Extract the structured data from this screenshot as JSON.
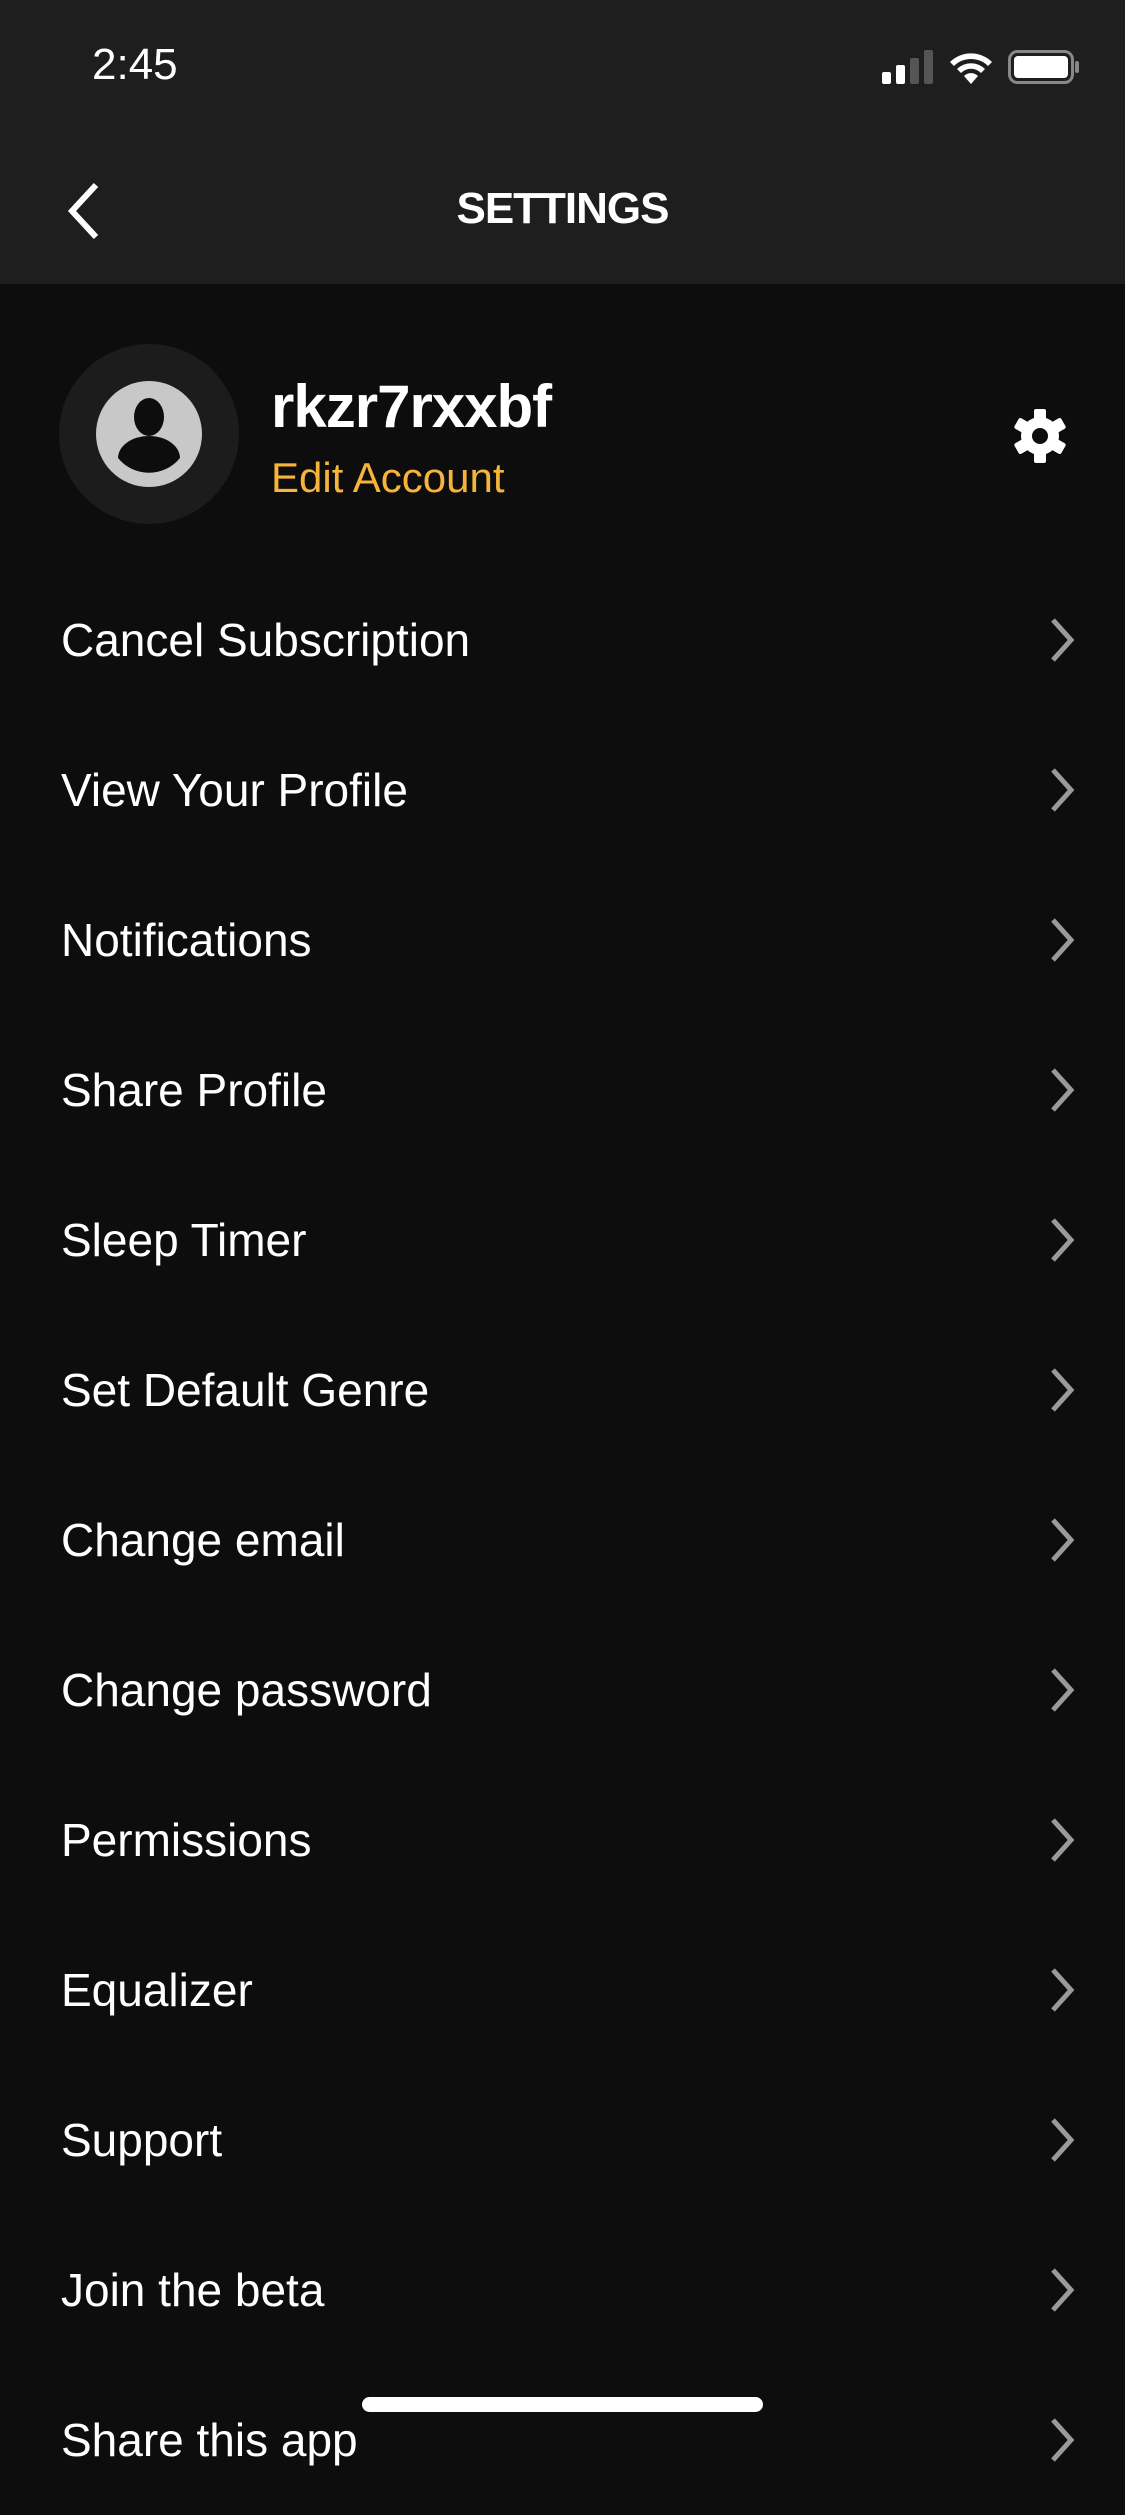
{
  "status_bar": {
    "time": "2:45",
    "icons": [
      "cellular-signal-icon",
      "wifi-icon",
      "battery-icon"
    ]
  },
  "header": {
    "title": "SETTINGS",
    "back_icon": "chevron-left-icon"
  },
  "profile": {
    "username": "rkzr7rxxbf",
    "edit_label": "Edit Account",
    "accent_color": "#f6b43c"
  },
  "menu": {
    "items": [
      {
        "label": "Cancel Subscription"
      },
      {
        "label": "View Your Profile"
      },
      {
        "label": "Notifications"
      },
      {
        "label": "Share Profile"
      },
      {
        "label": "Sleep Timer"
      },
      {
        "label": "Set Default Genre"
      },
      {
        "label": "Change email"
      },
      {
        "label": "Change password"
      },
      {
        "label": "Permissions"
      },
      {
        "label": "Equalizer"
      },
      {
        "label": "Support"
      },
      {
        "label": "Join the beta"
      },
      {
        "label": "Share this app"
      }
    ]
  }
}
